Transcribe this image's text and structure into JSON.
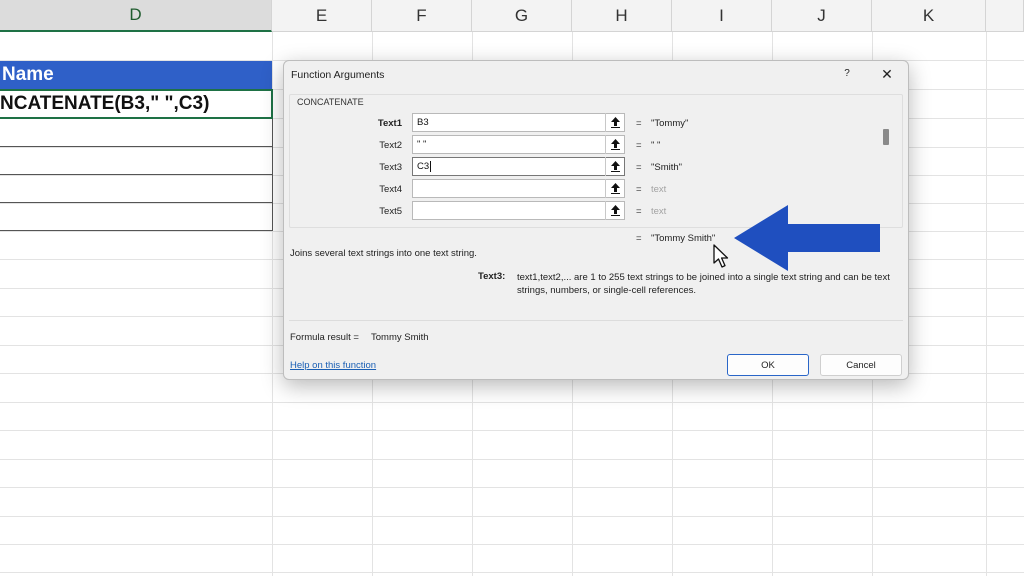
{
  "columns": [
    "D",
    "E",
    "F",
    "G",
    "H",
    "I",
    "J",
    "K"
  ],
  "cells": {
    "header": "Name",
    "formula": "NCATENATE(B3,\" \",C3)"
  },
  "dialog": {
    "title": "Function Arguments",
    "help_label": "?",
    "close_label": "✕",
    "function_name": "CONCATENATE",
    "arguments": [
      {
        "label": "Text1",
        "value": "B3",
        "result": "\"Tommy\"",
        "bold": true
      },
      {
        "label": "Text2",
        "value": "\" \"",
        "result": "\" \"",
        "bold": false
      },
      {
        "label": "Text3",
        "value": "C3",
        "result": "\"Smith\"",
        "bold": false
      },
      {
        "label": "Text4",
        "value": "",
        "result": "text",
        "bold": false
      },
      {
        "label": "Text5",
        "value": "",
        "result": "text",
        "bold": false
      }
    ],
    "equals": "=",
    "overall_result": "\"Tommy Smith\"",
    "description": "Joins several text strings into one text string.",
    "param_name": "Text3:",
    "param_description": "text1,text2,... are 1 to 255 text strings to be joined into a single text string and can be text strings, numbers, or single-cell references.",
    "formula_result_label": "Formula result =",
    "formula_result_value": "Tommy Smith",
    "help_link": "Help on this function",
    "ok_label": "OK",
    "cancel_label": "Cancel"
  },
  "colors": {
    "header_fill": "#2f60c8",
    "selection_border": "#1e7145",
    "annotation_arrow": "#1f4fbf",
    "link": "#1a5fb4"
  },
  "icons": {
    "ref_button": "collapse-dialog-arrow-icon",
    "annotation": "left-arrow-icon",
    "cursor": "mouse-pointer-icon"
  }
}
